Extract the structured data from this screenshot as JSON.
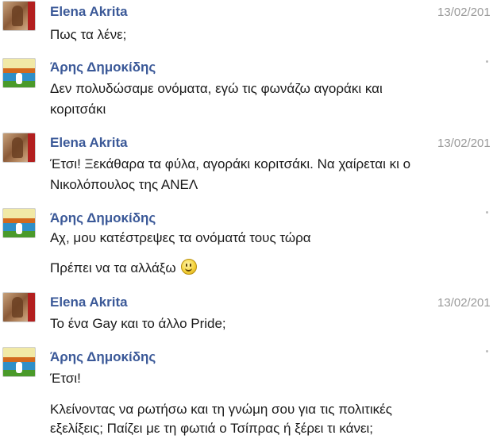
{
  "messages": [
    {
      "sender": "Elena Akrita",
      "date": "13/02/201",
      "lines": [
        "Πως τα λένε;"
      ]
    },
    {
      "sender": "Άρης Δημοκίδης",
      "lines": [
        "Δεν πολυδώσαμε ονόματα, εγώ τις φωνάζω αγοράκι και",
        "κοριτσάκι"
      ]
    },
    {
      "sender": "Elena Akrita",
      "date": "13/02/201",
      "lines": [
        "Έτσι! Ξεκάθαρα τα φύλα, αγοράκι κοριτσάκι. Να χαίρεται κι ο",
        "Νικολόπουλος της ΑΝΕΛ"
      ]
    },
    {
      "sender": "Άρης Δημοκίδης",
      "lines": [
        "Αχ, μου κατέστρεψες τα ονόματά τους τώρα",
        "Πρέπει να τα αλλάξω"
      ]
    },
    {
      "sender": "Elena Akrita",
      "date": "13/02/201",
      "lines": [
        "Το ένα Gay και το άλλο Pride;"
      ]
    },
    {
      "sender": "Άρης Δημοκίδης",
      "lines": [
        "Έτσι!",
        "Κλείνοντας να ρωτήσω και τη γνώμη σου για τις πολιτικές",
        "εξελίξεις; Παίζει με τη φωτιά ο Τσίπρας ή ξέρει τι κάνει;"
      ]
    }
  ],
  "icons": {
    "smiley": "smiley-emoticon-icon"
  },
  "colors": {
    "name": "#3b5998",
    "date": "#999999",
    "text": "#1a1a1a"
  }
}
